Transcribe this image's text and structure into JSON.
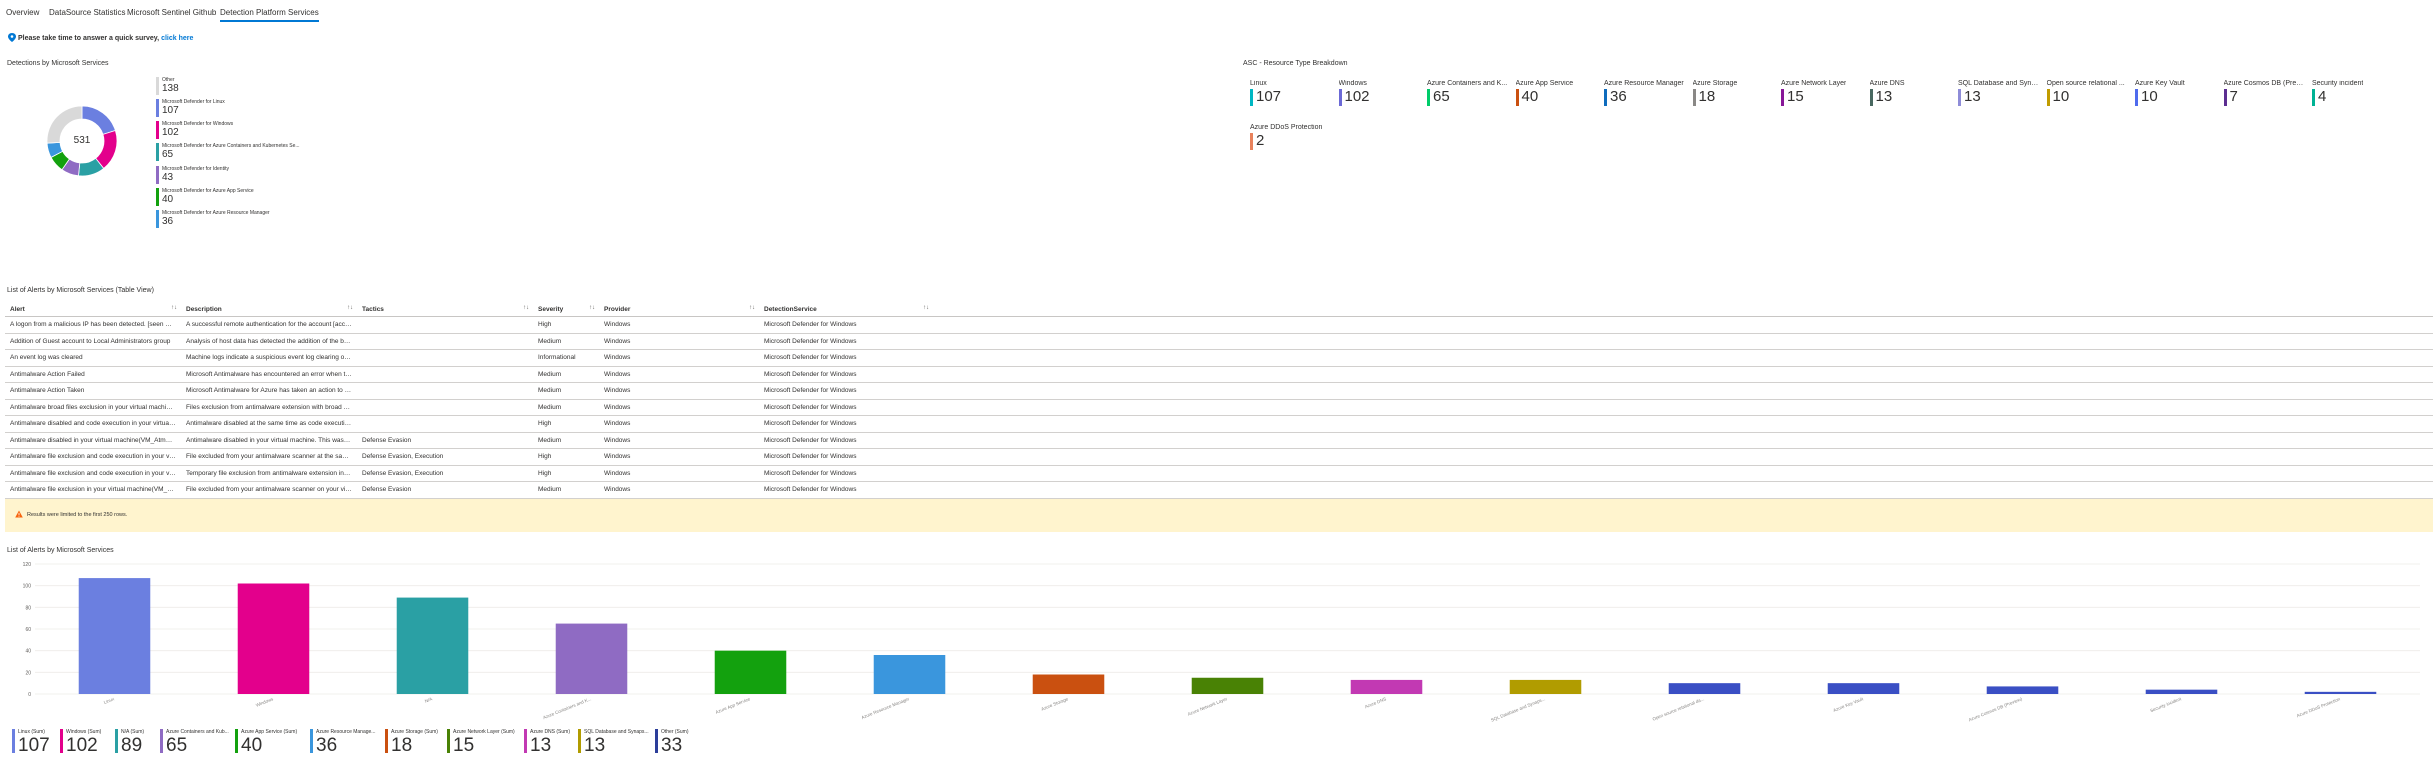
{
  "tabs": [
    "Overview",
    "DataSource Statistics",
    "Microsoft Sentinel Github",
    "Detection Platform Services"
  ],
  "survey": {
    "text": "Please take time to answer a quick survey,",
    "link": "click here"
  },
  "detections": {
    "title": "Detections by Microsoft Services",
    "total": "531",
    "items": [
      {
        "label": "Other",
        "value": "138",
        "count": 138,
        "color": "#d9d9d9"
      },
      {
        "label": "Microsoft Defender for Linux",
        "value": "107",
        "count": 107,
        "color": "#6b7fe0"
      },
      {
        "label": "Microsoft Defender for Windows",
        "value": "102",
        "count": 102,
        "color": "#e3008c"
      },
      {
        "label": "Microsoft Defender for Azure Containers and Kubernetes Se...",
        "value": "65",
        "count": 65,
        "color": "#2aa0a4"
      },
      {
        "label": "Microsoft Defender for Identity",
        "value": "43",
        "count": 43,
        "color": "#8f6bc3"
      },
      {
        "label": "Microsoft Defender for Azure App Service",
        "value": "40",
        "count": 40,
        "color": "#13a10e"
      },
      {
        "label": "Microsoft Defender for Azure Resource Manager",
        "value": "36",
        "count": 36,
        "color": "#3a96dd"
      }
    ]
  },
  "asc": {
    "title": "ASC - Resource Type Breakdown",
    "items": [
      {
        "label": "Linux",
        "value": "107",
        "color": "#00b7c3"
      },
      {
        "label": "Windows",
        "value": "102",
        "color": "#6b69d6"
      },
      {
        "label": "Azure Containers and K...",
        "value": "65",
        "color": "#00cc6a"
      },
      {
        "label": "Azure App Service",
        "value": "40",
        "color": "#ca5010"
      },
      {
        "label": "Azure Resource Manager",
        "value": "36",
        "color": "#0f6cbd"
      },
      {
        "label": "Azure Storage",
        "value": "18",
        "color": "#8a8886"
      },
      {
        "label": "Azure Network Layer",
        "value": "15",
        "color": "#881798"
      },
      {
        "label": "Azure DNS",
        "value": "13",
        "color": "#486860"
      },
      {
        "label": "SQL Database and Syna...",
        "value": "13",
        "color": "#8e8cd8"
      },
      {
        "label": "Open source relational ...",
        "value": "10",
        "color": "#c19c00"
      },
      {
        "label": "Azure Key Vault",
        "value": "10",
        "color": "#4f6bed"
      },
      {
        "label": "Azure Cosmos DB (Previ...",
        "value": "7",
        "color": "#5c2e91"
      },
      {
        "label": "Security incident",
        "value": "4",
        "color": "#00b294"
      },
      {
        "label": "Azure DDoS Protection",
        "value": "2",
        "color": "#e8825c"
      }
    ]
  },
  "table": {
    "title": "List of Alerts by Microsoft Services (Table View)",
    "columns": [
      "Alert",
      "Description",
      "Tactics",
      "Severity",
      "Provider",
      "DetectionService"
    ],
    "rows": [
      [
        "A logon from a malicious IP has been detected. [seen mul...",
        "A successful remote authentication for the account [acco...",
        "",
        "High",
        "Windows",
        "Microsoft Defender for Windows"
      ],
      [
        "Addition of Guest account to Local Administrators group",
        "Analysis of host data has detected the addition of the bui...",
        "",
        "Medium",
        "Windows",
        "Microsoft Defender for Windows"
      ],
      [
        "An event log was cleared",
        "Machine logs indicate a suspicious event log clearing ope...",
        "",
        "Informational",
        "Windows",
        "Microsoft Defender for Windows"
      ],
      [
        "Antimalware Action Failed",
        "Microsoft Antimalware has encountered an error when ta...",
        "",
        "Medium",
        "Windows",
        "Microsoft Defender for Windows"
      ],
      [
        "Antimalware Action Taken",
        "Microsoft Antimalware for Azure has taken an action to p...",
        "",
        "Medium",
        "Windows",
        "Microsoft Defender for Windows"
      ],
      [
        "Antimalware broad files exclusion in your virtual machine...",
        "Files exclusion from antimalware extension with broad ex...",
        "",
        "Medium",
        "Windows",
        "Microsoft Defender for Windows"
      ],
      [
        "Antimalware disabled and code execution in your virtual ...",
        "Antimalware disabled at the same time as code execution...",
        "",
        "High",
        "Windows",
        "Microsoft Defender for Windows"
      ],
      [
        "Antimalware disabled in your virtual machine(VM_AtmDis...",
        "Antimalware disabled in your virtual machine. This was de...",
        "Defense Evasion",
        "Medium",
        "Windows",
        "Microsoft Defender for Windows"
      ],
      [
        "Antimalware file exclusion and code execution in your virt...",
        "File excluded from your antimalware scanner at the same ...",
        "Defense Evasion, Execution",
        "High",
        "Windows",
        "Microsoft Defender for Windows"
      ],
      [
        "Antimalware file exclusion and code execution in your virt...",
        "Temporary file exclusion from antimalware extension in p...",
        "Defense Evasion, Execution",
        "High",
        "Windows",
        "Microsoft Defender for Windows"
      ],
      [
        "Antimalware file exclusion in your virtual machine(VM_A...",
        "File excluded from your antimalware scanner on your virt...",
        "Defense Evasion",
        "Medium",
        "Windows",
        "Microsoft Defender for Windows"
      ]
    ],
    "warning": "Results were limited to the first 250 rows."
  },
  "barchart": {
    "title": "List of Alerts by Microsoft Services",
    "legend": [
      {
        "label": "Linux (Sum)",
        "value": "107",
        "color": "#6b7fe0"
      },
      {
        "label": "Windows (Sum)",
        "value": "102",
        "color": "#e3008c"
      },
      {
        "label": "N/A (Sum)",
        "value": "89",
        "color": "#2aa0a4"
      },
      {
        "label": "Azure Containers and Kub...",
        "value": "65",
        "color": "#8f6bc3"
      },
      {
        "label": "Azure App Service (Sum)",
        "value": "40",
        "color": "#13a10e"
      },
      {
        "label": "Azure Resource Manage...",
        "value": "36",
        "color": "#3a96dd"
      },
      {
        "label": "Azure Storage (Sum)",
        "value": "18",
        "color": "#ca5010"
      },
      {
        "label": "Azure Network Layer (Sum)",
        "value": "15",
        "color": "#498205"
      },
      {
        "label": "Azure DNS (Sum)",
        "value": "13",
        "color": "#c239b3"
      },
      {
        "label": "SQL Database and Synaps...",
        "value": "13",
        "color": "#b19c00"
      },
      {
        "label": "Other (Sum)",
        "value": "33",
        "color": "#2c3e9a"
      }
    ]
  },
  "chart_data": {
    "type": "bar",
    "categories": [
      "Linux",
      "Windows",
      "N/A",
      "Azure Containers and K...",
      "Azure App Service",
      "Azure Resource Manager",
      "Azure Storage",
      "Azure Network Layer",
      "Azure DNS",
      "SQL Database and Synaps...",
      "Open source relational da...",
      "Azure Key Vault",
      "Azure Cosmos DB (Preview)",
      "Security incident",
      "Azure DDoS Protection"
    ],
    "values": [
      107,
      102,
      89,
      65,
      40,
      36,
      18,
      15,
      13,
      13,
      10,
      10,
      7,
      4,
      2
    ],
    "colors": [
      "#6b7fe0",
      "#e3008c",
      "#2aa0a4",
      "#8f6bc3",
      "#13a10e",
      "#3a96dd",
      "#ca5010",
      "#498205",
      "#c239b3",
      "#b19c00",
      "#3a4fc4",
      "#3a4fc4",
      "#3a4fc4",
      "#3a4fc4",
      "#3a4fc4"
    ],
    "yticks": [
      "0",
      "20",
      "40",
      "60",
      "80",
      "100",
      "120"
    ],
    "ylim": [
      0,
      120
    ]
  }
}
